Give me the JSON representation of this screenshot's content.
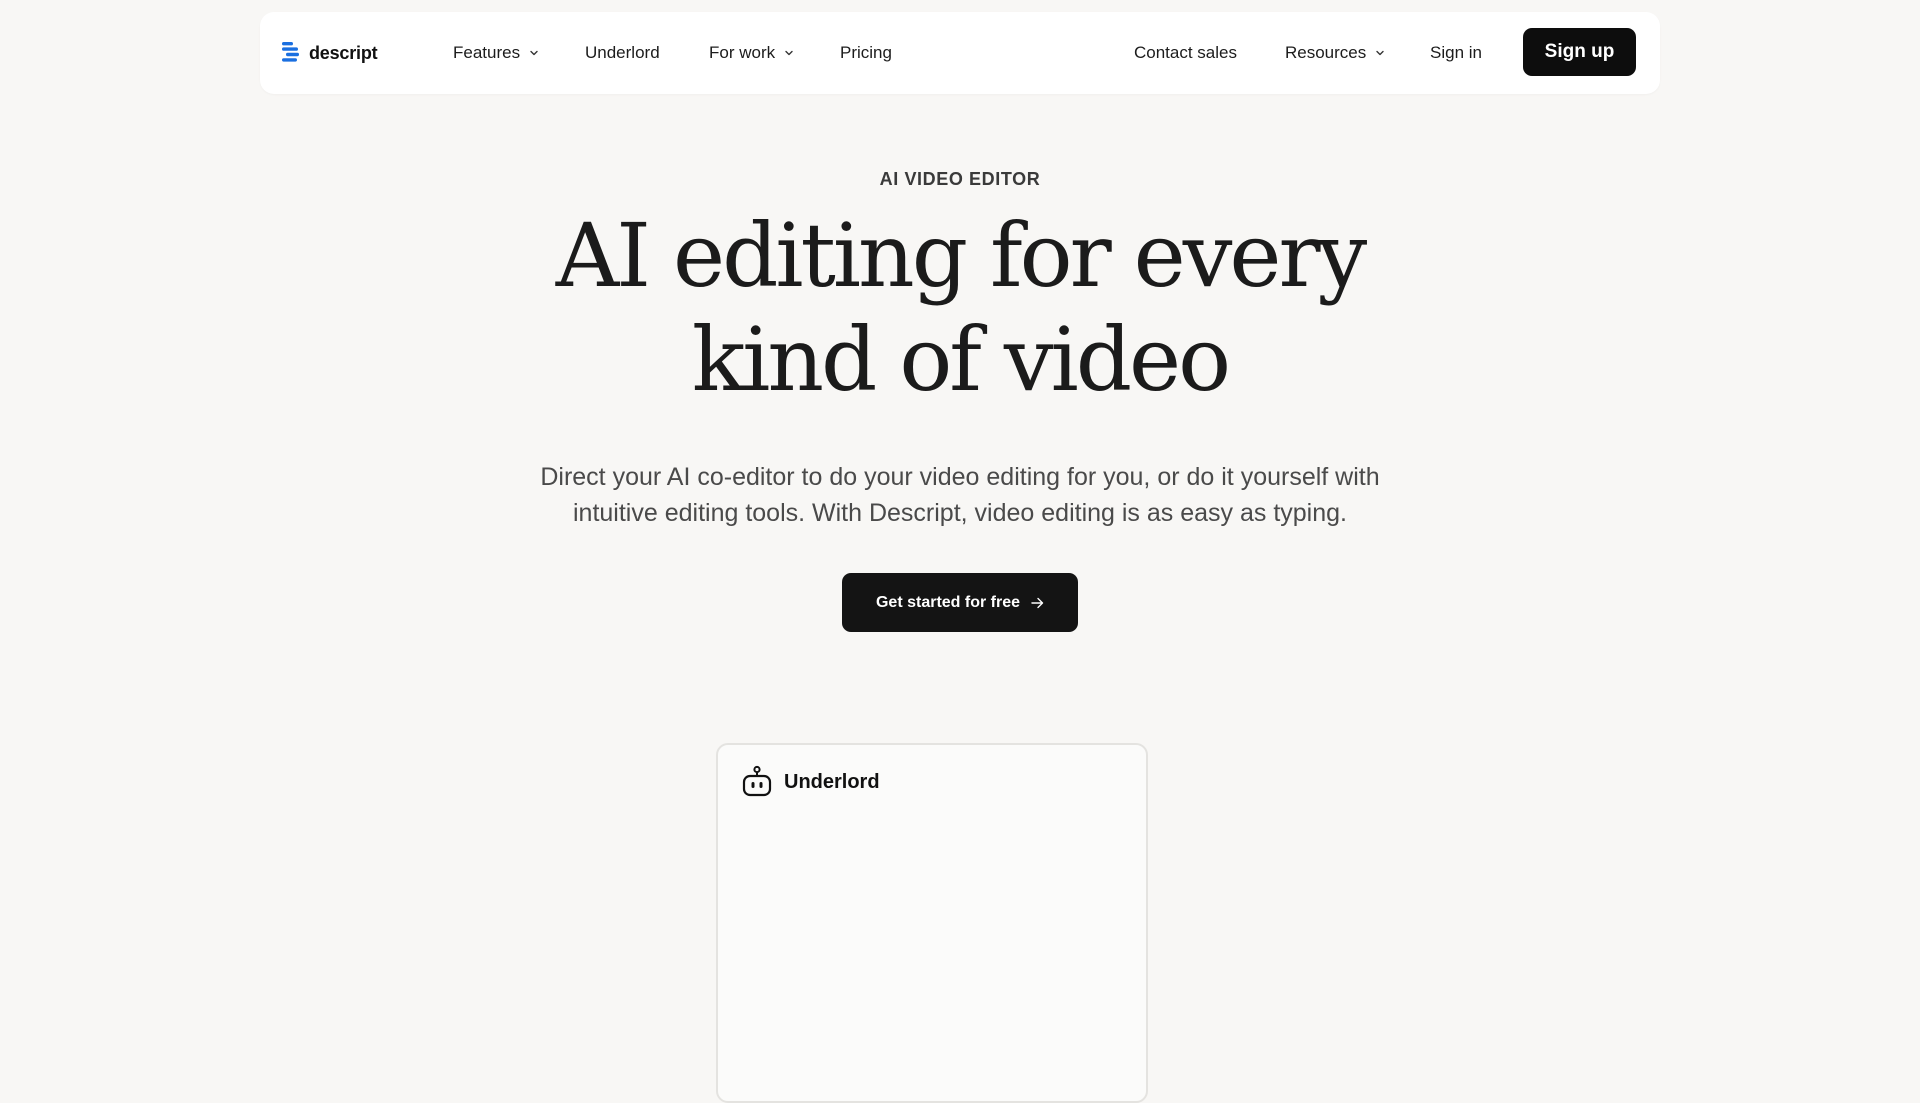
{
  "brand": {
    "name": "descript",
    "accent": "#1a6fe0"
  },
  "nav": {
    "left": [
      {
        "label": "Features",
        "dropdown": true
      },
      {
        "label": "Underlord",
        "dropdown": false
      },
      {
        "label": "For work",
        "dropdown": true
      },
      {
        "label": "Pricing",
        "dropdown": false
      }
    ],
    "right": [
      {
        "label": "Contact sales",
        "dropdown": false
      },
      {
        "label": "Resources",
        "dropdown": true
      },
      {
        "label": "Sign in",
        "dropdown": false
      }
    ],
    "signup_label": "Sign up"
  },
  "hero": {
    "eyebrow": "AI VIDEO EDITOR",
    "headline_line1": "AI editing for every",
    "headline_line2": "kind of video",
    "subhead_line1": "Direct your AI co-editor to do your video editing for you, or do it yourself with",
    "subhead_line2": "intuitive editing tools. With Descript, video editing is as easy as typing.",
    "cta_label": "Get started for free",
    "cta_icon": "arrow-right-icon"
  },
  "panel": {
    "icon": "robot-icon",
    "title": "Underlord"
  },
  "colors": {
    "background": "#f8f7f5",
    "nav_background": "#ffffff",
    "button_dark": "#0d0d0d",
    "text_primary": "#1b1b1b",
    "text_secondary": "#4a4a4a"
  }
}
